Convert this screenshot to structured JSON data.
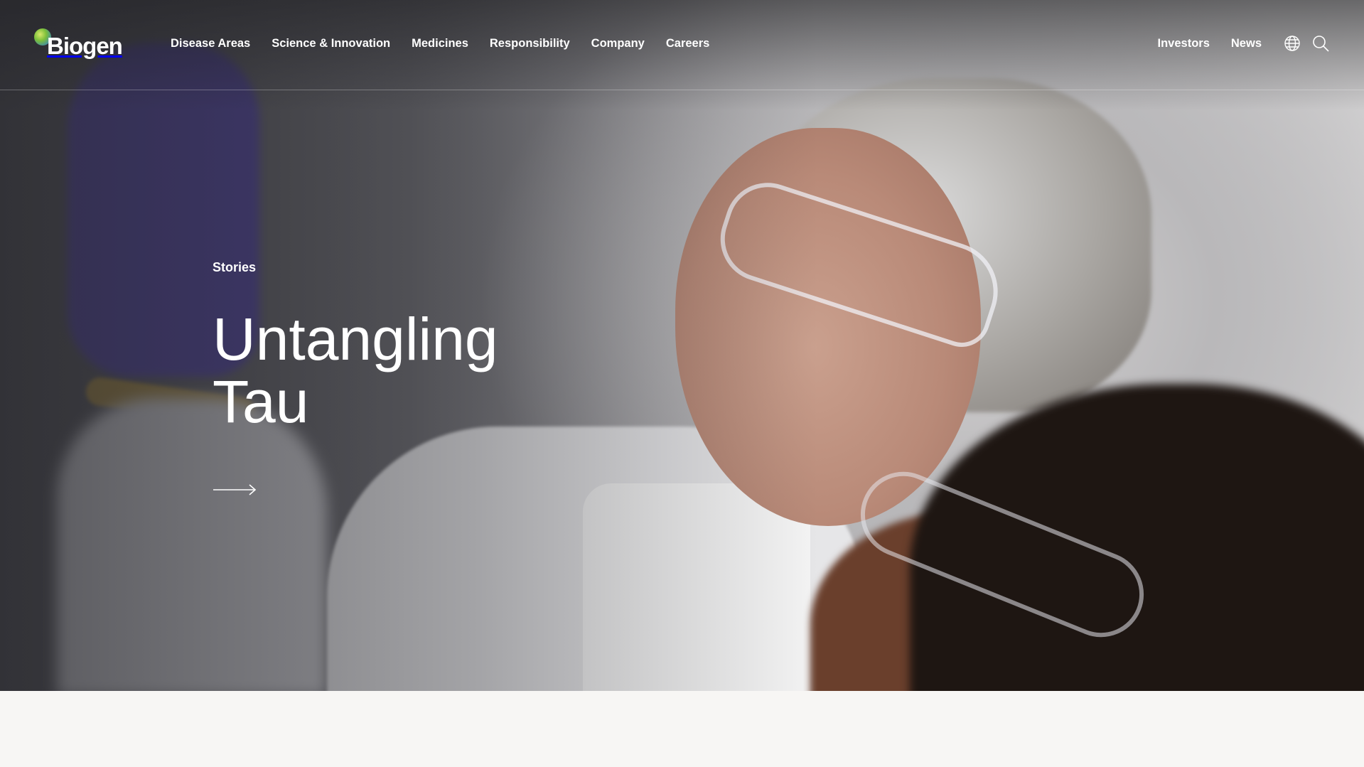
{
  "header": {
    "logo_text": "Biogen",
    "nav": [
      "Disease Areas",
      "Science & Innovation",
      "Medicines",
      "Responsibility",
      "Company",
      "Careers"
    ],
    "utility": [
      "Investors",
      "News"
    ],
    "icons": [
      "globe-icon",
      "search-icon"
    ]
  },
  "hero": {
    "eyebrow": "Stories",
    "headline_line1": "Untangling",
    "headline_line2": "Tau",
    "cta_icon": "arrow-right-icon"
  }
}
